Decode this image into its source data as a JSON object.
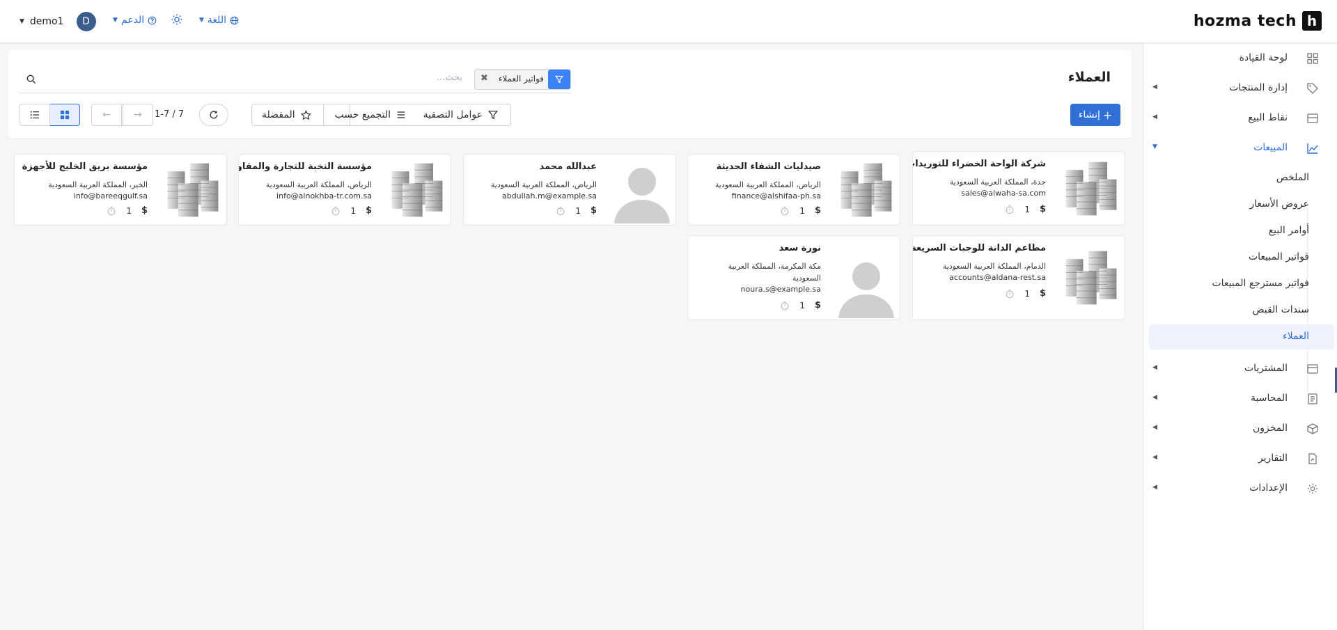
{
  "topbar": {
    "brand": "hozma tech",
    "brand_letter": "h",
    "user_name": "demo1",
    "user_initial": "D",
    "support_label": "الدعم",
    "language_label": "اللغة"
  },
  "sidebar": {
    "items": [
      {
        "label": "لوحة القيادة",
        "icon": "dashboard-icon"
      },
      {
        "label": "إدارة المنتجات",
        "icon": "tag-icon"
      },
      {
        "label": "نقاط البيع",
        "icon": "store-icon"
      },
      {
        "label": "المبيعات",
        "icon": "chart-line-icon"
      },
      {
        "label": "المشتريات",
        "icon": "wallet-icon"
      },
      {
        "label": "المحاسبة",
        "icon": "ledger-icon"
      },
      {
        "label": "المخزون",
        "icon": "box-icon"
      },
      {
        "label": "التقارير",
        "icon": "report-icon"
      },
      {
        "label": "الإعدادات",
        "icon": "gear-icon"
      }
    ],
    "sales_sub": [
      "الملخص",
      "عروض الأسعار",
      "أوامر البيع",
      "فواتير المبيعات",
      "فواتير مسترجع المبيعات",
      "سندات القبض",
      "العملاء"
    ]
  },
  "main": {
    "title": "العملاء",
    "search_placeholder": "بحث...",
    "facet_label": "فواتير العملاء",
    "create_label": "إنشاء",
    "filters_label": "عوامل التصفية",
    "group_by_label": "التجميع حسب",
    "favorites_label": "المفضلة",
    "pager": "1-7 / 7"
  },
  "cards": [
    {
      "name": "شركة الواحة الخضراء للتوريدات",
      "address": "جدة، المملكة العربية السعودية",
      "email": "sales@alwaha-sa.com",
      "count": "1",
      "type": "company"
    },
    {
      "name": "صيدليات الشفاء الحديثة",
      "address": "الرياض، المملكة العربية السعودية",
      "email": "finance@alshifaa-ph.sa",
      "count": "1",
      "type": "company"
    },
    {
      "name": "عبدالله محمد",
      "address": "الرياض، المملكة العربية السعودية",
      "email": "abdullah.m@example.sa",
      "count": "1",
      "type": "person"
    },
    {
      "name": "مؤسسة النخبة للتجارة والمقاولات",
      "address": "الرياض، المملكة العربية السعودية",
      "email": "info@alnokhba-tr.com.sa",
      "count": "1",
      "type": "company"
    },
    {
      "name": "مؤسسة بريق الخليج للأجهزة",
      "address": "الخبر، المملكة العربية السعودية",
      "email": "info@bareeqgulf.sa",
      "count": "1",
      "type": "company"
    },
    {
      "name": "مطاعم الدانة للوجبات السريعة",
      "address": "الدمام، المملكة العربية السعودية",
      "email": "accounts@aldana-rest.sa",
      "count": "1",
      "type": "company"
    },
    {
      "name": "نورة سعد",
      "address": "مكة المكرمة، المملكة العربية السعودية",
      "email": "noura.s@example.sa",
      "count": "1",
      "type": "person"
    }
  ],
  "colors": {
    "accent": "#2f6fd6",
    "avatar": "#3b5c8c"
  }
}
